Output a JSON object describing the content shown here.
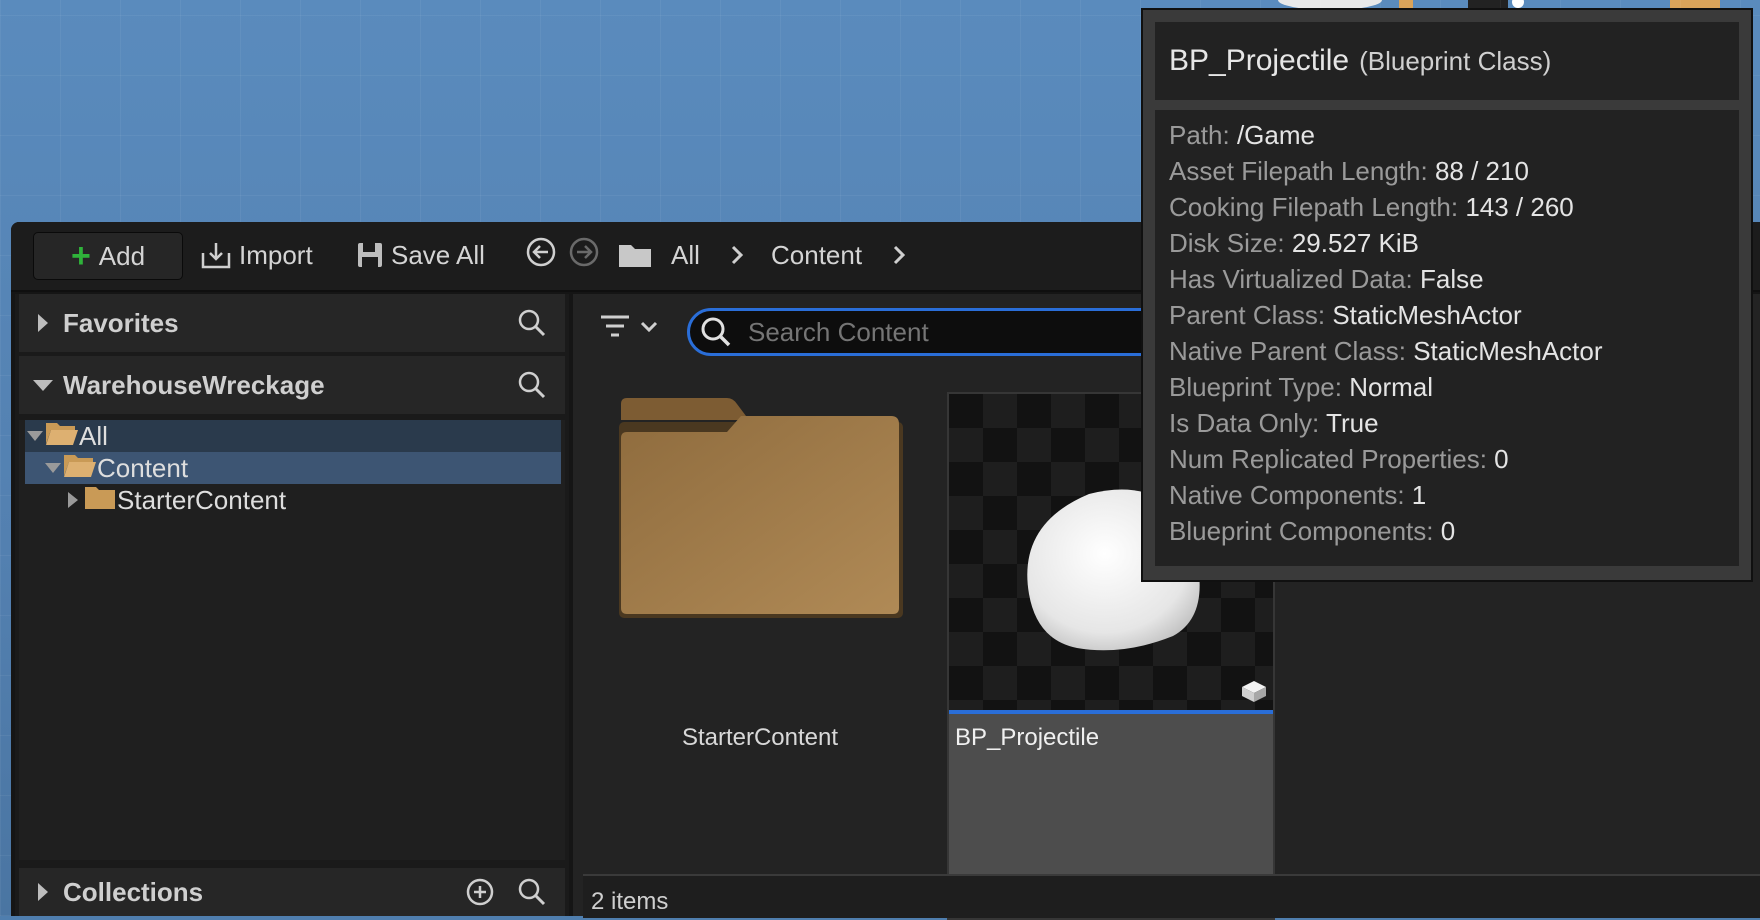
{
  "toolbar": {
    "add_label": "Add",
    "import_label": "Import",
    "save_all_label": "Save All"
  },
  "breadcrumb": [
    "All",
    "Content"
  ],
  "sources": {
    "favorites_label": "Favorites",
    "project_label": "WarehouseWreckage",
    "tree": [
      {
        "label": "All",
        "expanded": true
      },
      {
        "label": "Content",
        "expanded": true,
        "selected": true
      },
      {
        "label": "StarterContent",
        "expanded": false
      }
    ],
    "collections_label": "Collections"
  },
  "search": {
    "placeholder": "Search Content"
  },
  "assets": [
    {
      "name": "StarterContent",
      "kind": "folder"
    },
    {
      "name": "BP_Projectile",
      "type": "Blueprint Class"
    }
  ],
  "status": {
    "count": "2 items"
  },
  "tooltip": {
    "title": "BP_Projectile",
    "type": "(Blueprint Class)",
    "rows": [
      {
        "key": "Path:",
        "value": "/Game"
      },
      {
        "key": "Asset Filepath Length:",
        "value": "88 / 210"
      },
      {
        "key": "Cooking Filepath Length:",
        "value": "143 / 260"
      },
      {
        "key": "Disk Size:",
        "value": "29.527 KiB"
      },
      {
        "key": "Has Virtualized Data:",
        "value": "False"
      },
      {
        "key": "Parent Class:",
        "value": "StaticMeshActor"
      },
      {
        "key": "Native Parent Class:",
        "value": "StaticMeshActor"
      },
      {
        "key": "Blueprint Type:",
        "value": "Normal"
      },
      {
        "key": "Is Data Only:",
        "value": "True"
      },
      {
        "key": "Num Replicated Properties:",
        "value": "0"
      },
      {
        "key": "Native Components:",
        "value": "1"
      },
      {
        "key": "Blueprint Components:",
        "value": "0"
      }
    ]
  },
  "colors": {
    "accent": "#2a6ed8",
    "folder": "#a6814d",
    "add_plus": "#2fb33a",
    "selection": "#3d5573"
  }
}
